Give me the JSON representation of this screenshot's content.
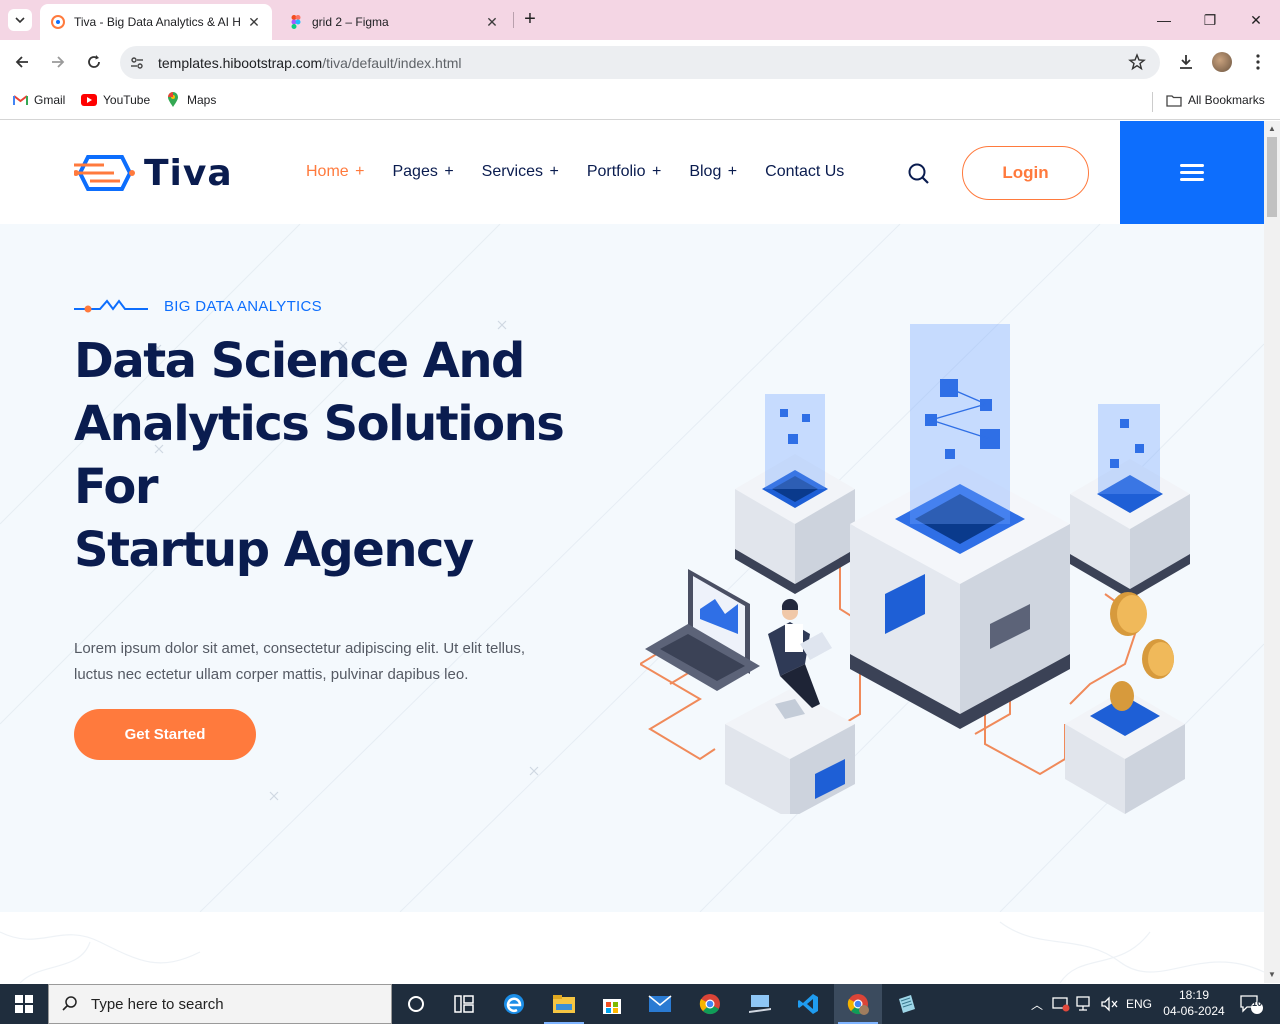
{
  "browser": {
    "tabs": [
      {
        "title": "Tiva - Big Data Analytics & AI H",
        "active": true
      },
      {
        "title": "grid 2 – Figma",
        "active": false
      }
    ],
    "url_host": "templates.hibootstrap.com",
    "url_path": "/tiva/default/index.html",
    "bookmarks": [
      {
        "label": "Gmail",
        "icon": "gmail-icon"
      },
      {
        "label": "YouTube",
        "icon": "youtube-icon"
      },
      {
        "label": "Maps",
        "icon": "maps-icon"
      }
    ],
    "all_bookmarks_label": "All Bookmarks"
  },
  "site": {
    "brand": "Tiva",
    "nav": [
      {
        "label": "Home",
        "suffix": "+",
        "active": true
      },
      {
        "label": "Pages",
        "suffix": "+",
        "active": false
      },
      {
        "label": "Services",
        "suffix": "+",
        "active": false
      },
      {
        "label": "Portfolio",
        "suffix": "+",
        "active": false
      },
      {
        "label": "Blog",
        "suffix": "+",
        "active": false
      },
      {
        "label": "Contact Us",
        "suffix": "",
        "active": false
      }
    ],
    "login_label": "Login",
    "colors": {
      "accent": "#ff7a3d",
      "primary": "#0d6efd",
      "heading": "#0a1c4f",
      "hero_bg": "#f4f9fd"
    }
  },
  "hero": {
    "eyebrow": "BIG DATA ANALYTICS",
    "title_lines": [
      "Data Science And",
      "Analytics Solutions For",
      "Startup Agency"
    ],
    "description_lines": [
      "Lorem ipsum dolor sit amet, consectetur adipiscing elit. Ut elit tellus,",
      "luctus nec ectetur ullam corper mattis, pulvinar dapibus leo."
    ],
    "cta_label": "Get Started"
  },
  "taskbar": {
    "search_placeholder": "Type here to search",
    "language": "ENG",
    "time": "18:19",
    "date": "04-06-2024",
    "notification_count": "10"
  }
}
